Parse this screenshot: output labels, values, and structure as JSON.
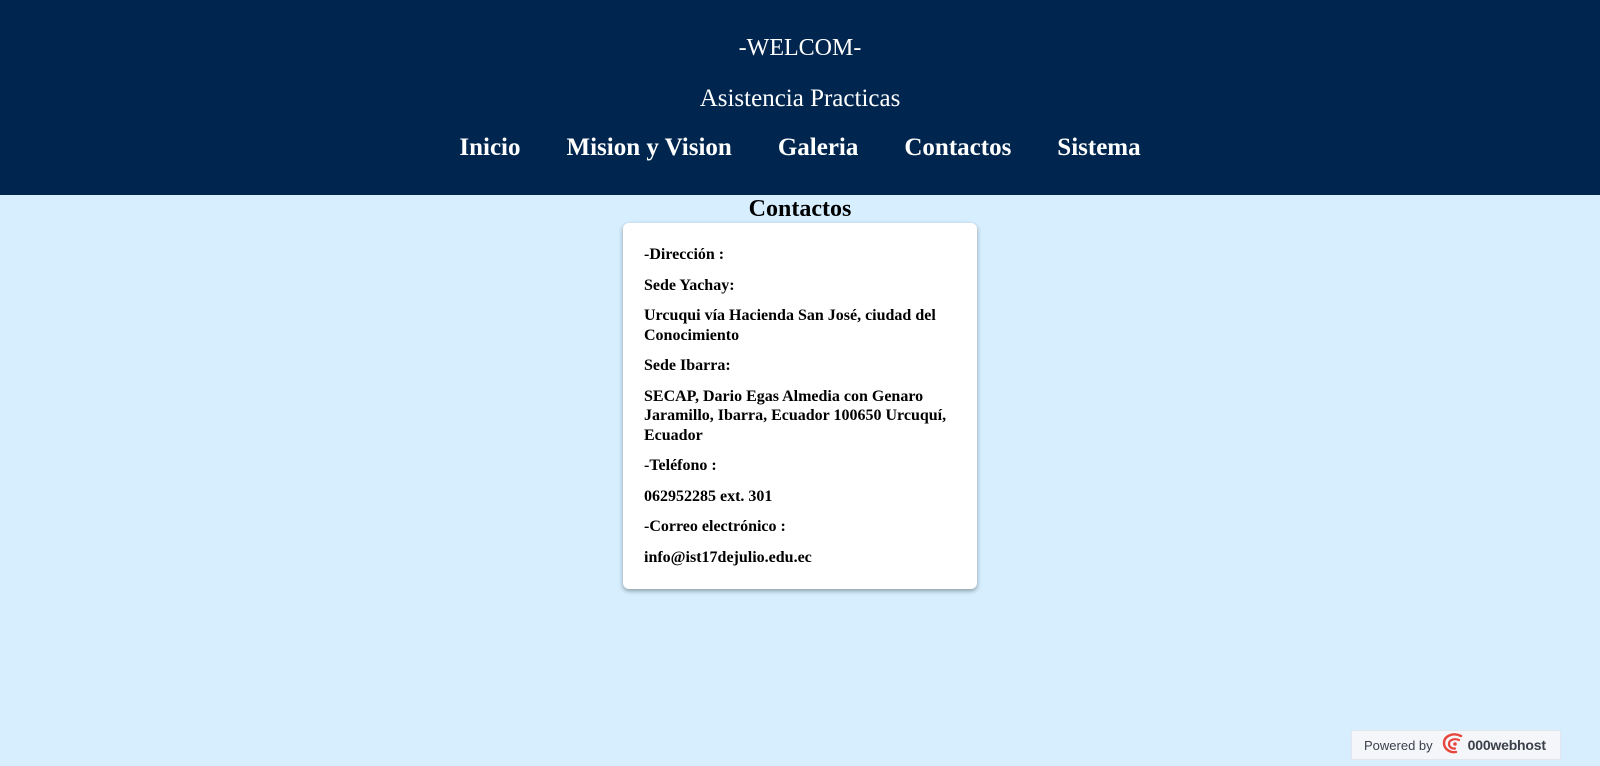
{
  "header": {
    "welcome": "-WELCOM-",
    "subtitle": "Asistencia Practicas",
    "nav": [
      {
        "label": "Inicio"
      },
      {
        "label": "Mision y Vision"
      },
      {
        "label": "Galeria"
      },
      {
        "label": "Contactos"
      },
      {
        "label": "Sistema"
      }
    ]
  },
  "section": {
    "title": "Contactos"
  },
  "contact": {
    "direccion_label": "-Dirección :",
    "sede_yachay_label": "Sede Yachay:",
    "sede_yachay_address": "Urcuqui vía Hacienda San José, ciudad del Conocimiento",
    "sede_ibarra_label": "Sede Ibarra:",
    "sede_ibarra_address": "SECAP, Dario Egas Almedia con Genaro Jaramillo, Ibarra, Ecuador 100650 Urcuquí, Ecuador",
    "telefono_label": "-Teléfono :",
    "telefono_value": "062952285 ext. 301",
    "correo_label": "-Correo electrónico :",
    "correo_value": "info@ist17dejulio.edu.ec"
  },
  "badge": {
    "powered_by": "Powered by",
    "brand": "000webhost",
    "icon": "000webhost-logo-icon",
    "brand_color": "#e8463d"
  },
  "colors": {
    "header_bg": "#00264f",
    "page_bg": "#d6eefe",
    "card_bg": "#ffffff"
  }
}
